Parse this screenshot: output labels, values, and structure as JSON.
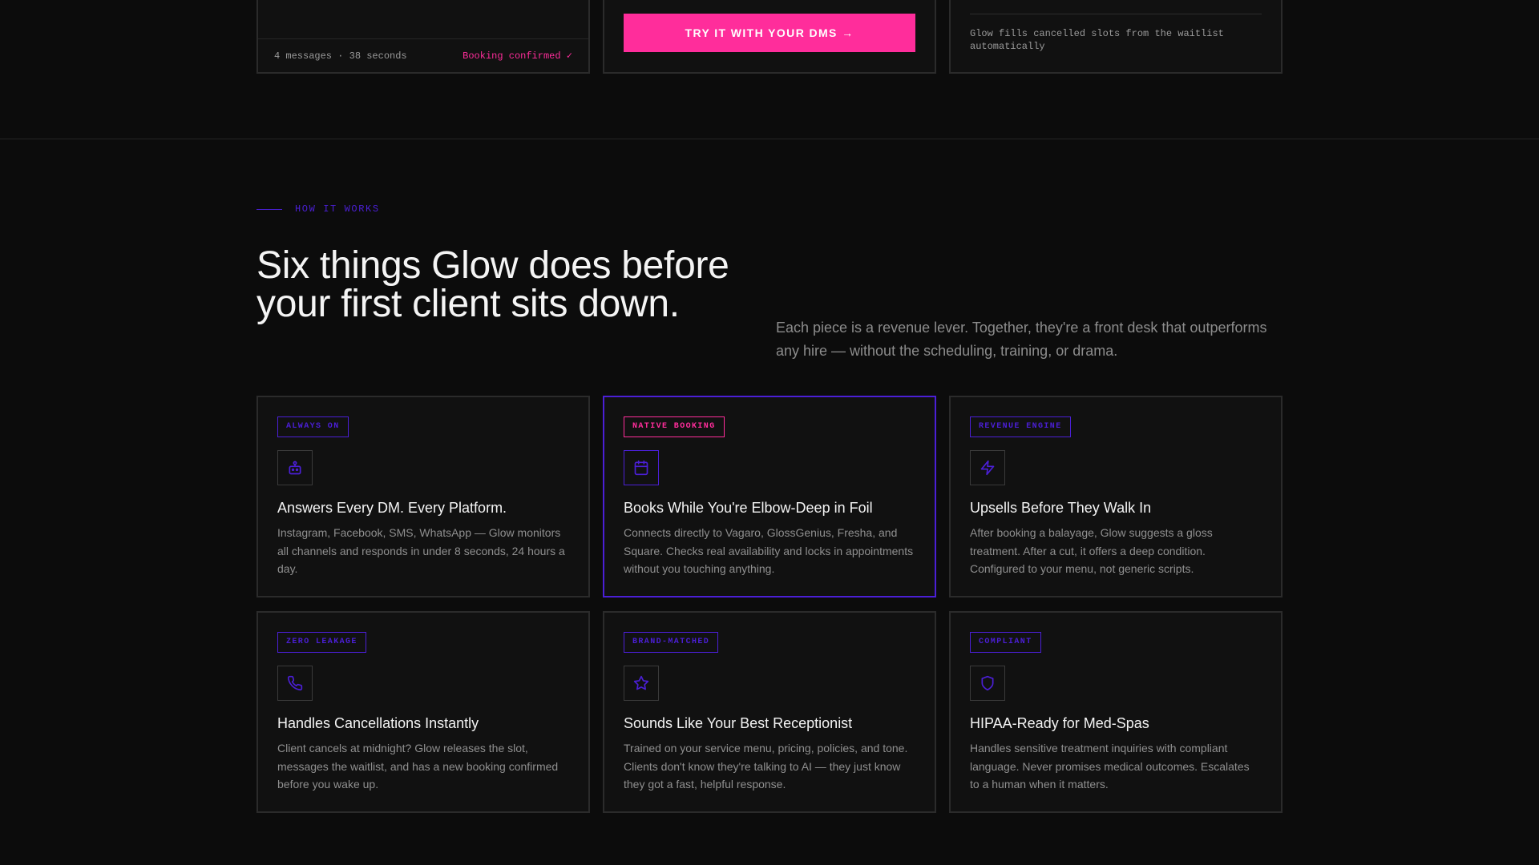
{
  "top_strip": {
    "card1_footer": {
      "meta": "4 messages · 38 seconds",
      "status": "Booking confirmed ✓"
    },
    "cta_label": "TRY IT WITH YOUR DMS →",
    "card3_text": "Glow fills cancelled slots from the waitlist automatically"
  },
  "section": {
    "eyebrow": "HOW IT WORKS",
    "headline": "Six things Glow does before your first client sits down.",
    "intro": "Each piece is a revenue lever. Together, they're a front desk that outperforms any hire — without the scheduling, training, or drama."
  },
  "colors": {
    "accent_pink": "#ff2d9b",
    "accent_purple": "#4b1fd6",
    "background": "#0c0c0c"
  },
  "features": [
    {
      "tag": "ALWAYS ON",
      "icon": "robot-icon",
      "title": "Answers Every DM. Every Platform.",
      "body": "Instagram, Facebook, SMS, WhatsApp — Glow monitors all channels and responds in under 8 seconds, 24 hours a day."
    },
    {
      "tag": "NATIVE BOOKING",
      "icon": "calendar-icon",
      "title": "Books While You're Elbow-Deep in Foil",
      "body": "Connects directly to Vagaro, GlossGenius, Fresha, and Square. Checks real availability and locks in appointments without you touching anything."
    },
    {
      "tag": "REVENUE ENGINE",
      "icon": "lightning-icon",
      "title": "Upsells Before They Walk In",
      "body": "After booking a balayage, Glow suggests a gloss treatment. After a cut, it offers a deep condition. Configured to your menu, not generic scripts."
    },
    {
      "tag": "ZERO LEAKAGE",
      "icon": "phone-icon",
      "title": "Handles Cancellations Instantly",
      "body": "Client cancels at midnight? Glow releases the slot, messages the waitlist, and has a new booking confirmed before you wake up."
    },
    {
      "tag": "BRAND-MATCHED",
      "icon": "star-icon",
      "title": "Sounds Like Your Best Receptionist",
      "body": "Trained on your service menu, pricing, policies, and tone. Clients don't know they're talking to AI — they just know they got a fast, helpful response."
    },
    {
      "tag": "COMPLIANT",
      "icon": "shield-icon",
      "title": "HIPAA-Ready for Med-Spas",
      "body": "Handles sensitive treatment inquiries with compliant language. Never promises medical outcomes. Escalates to a human when it matters."
    }
  ]
}
